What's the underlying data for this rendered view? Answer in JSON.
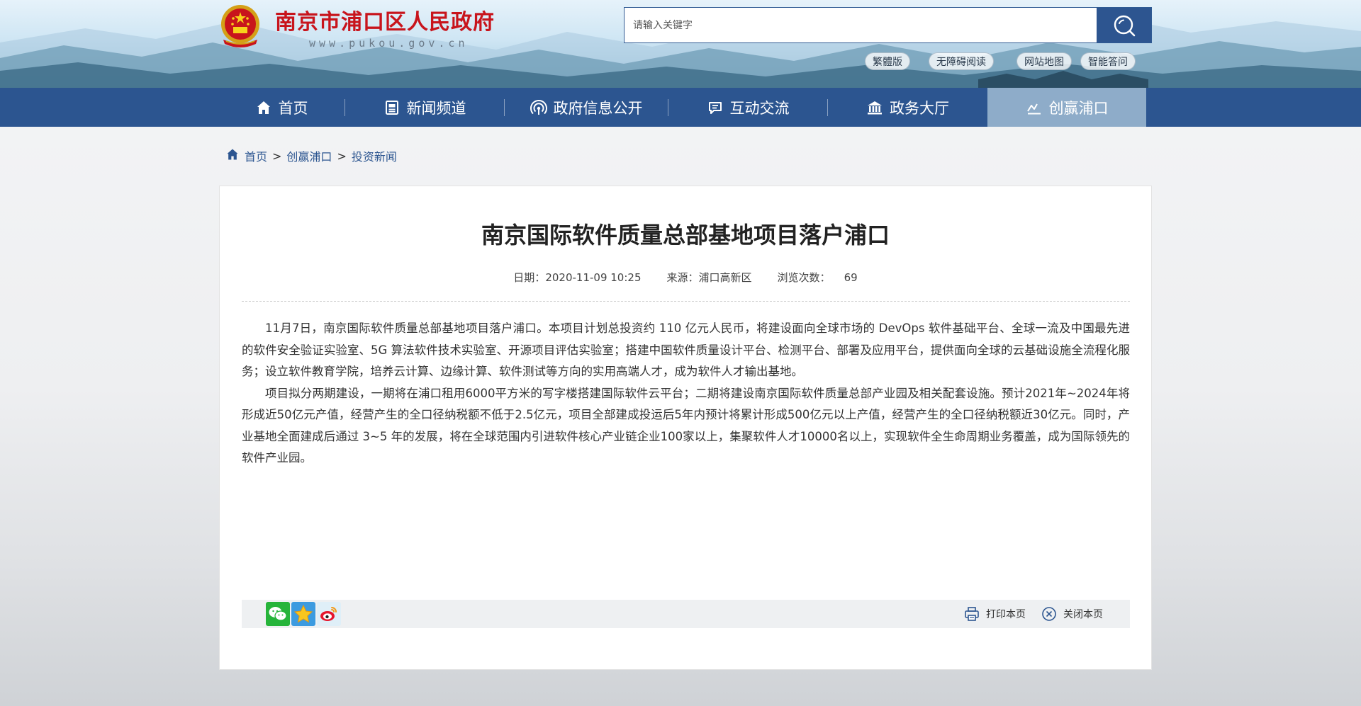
{
  "header": {
    "site_title": "南京市浦口区人民政府",
    "site_url": "www.pukou.gov.cn",
    "search": {
      "placeholder": "请输入关键字",
      "button_icon": "search-icon"
    },
    "quick_links": [
      "繁體版",
      "无障碍阅读",
      "网站地图",
      "智能答问"
    ]
  },
  "nav": {
    "items": [
      {
        "label": "首页",
        "icon": "home-icon",
        "active": false
      },
      {
        "label": "新闻频道",
        "icon": "newspaper-icon",
        "active": false
      },
      {
        "label": "政府信息公开",
        "icon": "broadcast-icon",
        "active": false
      },
      {
        "label": "互动交流",
        "icon": "chat-icon",
        "active": false
      },
      {
        "label": "政务大厅",
        "icon": "government-building-icon",
        "active": false
      },
      {
        "label": "创赢浦口",
        "icon": "chart-line-icon",
        "active": true
      }
    ]
  },
  "breadcrumb": {
    "icon": "home-icon",
    "items": [
      "首页",
      "创赢浦口",
      "投资新闻"
    ],
    "separator": ">"
  },
  "article": {
    "title": "南京国际软件质量总部基地项目落户浦口",
    "meta": {
      "date_label": "日期：",
      "date": "2020-11-09 10:25",
      "source_label": "来源：",
      "source": "浦口高新区",
      "views_label": "浏览次数：",
      "views": "69"
    },
    "paragraphs": [
      "11月7日，南京国际软件质量总部基地项目落户浦口。本项目计划总投资约 110 亿元人民币，将建设面向全球市场的 DevOps 软件基础平台、全球一流及中国最先进的软件安全验证实验室、5G 算法软件技术实验室、开源项目评估实验室；搭建中国软件质量设计平台、检测平台、部署及应用平台，提供面向全球的云基础设施全流程化服务；设立软件教育学院，培养云计算、边缘计算、软件测试等方向的实用高端人才，成为软件人才输出基地。",
      "项目拟分两期建设，一期将在浦口租用6000平方米的写字楼搭建国际软件云平台；二期将建设南京国际软件质量总部产业园及相关配套设施。预计2021年~2024年将形成近50亿元产值，经营产生的全口径纳税额不低于2.5亿元，项目全部建成投运后5年内预计将累计形成500亿元以上产值，经营产生的全口径纳税额近30亿元。同时，产业基地全面建成后通过 3~5 年的发展，将在全球范围内引进软件核心产业链企业100家以上，集聚软件人才10000名以上，实现软件全生命周期业务覆盖，成为国际领先的软件产业园。"
    ]
  },
  "share": {
    "icons": [
      "wechat-icon",
      "qzone-icon",
      "weibo-icon"
    ]
  },
  "actions": {
    "print_label": "打印本页",
    "close_label": "关闭本页"
  },
  "colors": {
    "nav_bg": "#2c5590",
    "nav_active_bg": "#8eacc9",
    "title_red": "#c8141c",
    "link_blue": "#2c5590"
  }
}
